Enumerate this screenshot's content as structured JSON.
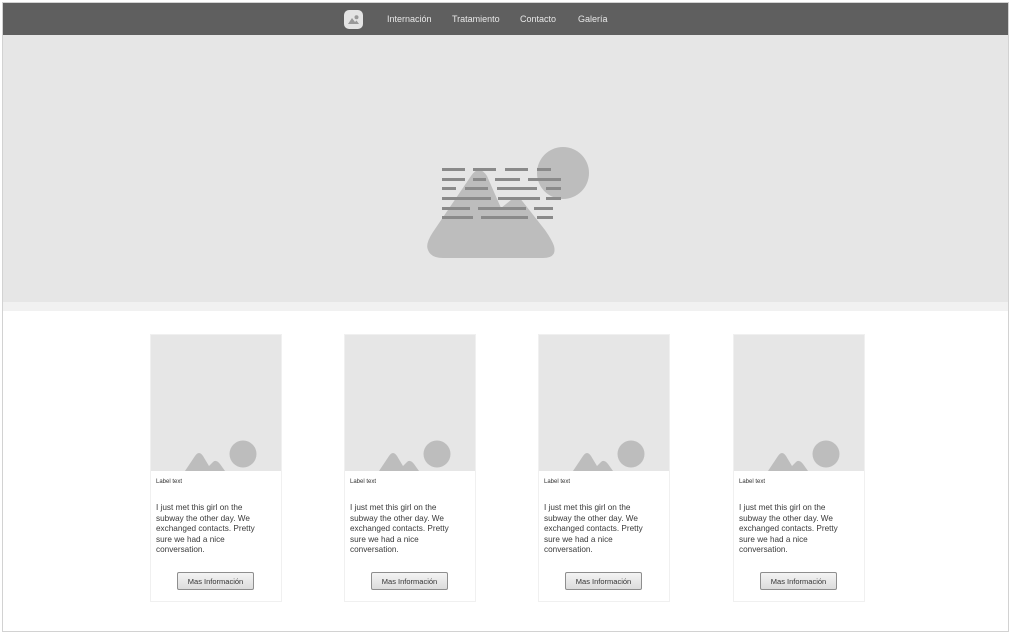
{
  "navbar": {
    "logo_icon": "image-icon",
    "items": [
      {
        "label": "Internación"
      },
      {
        "label": "Tratamiento"
      },
      {
        "label": "Contacto"
      },
      {
        "label": "Galería"
      }
    ]
  },
  "hero": {
    "image_icon": "image-placeholder-icon"
  },
  "cards": [
    {
      "label": "Label text",
      "text": "I just met this girl on the subway the other day. We exchanged contacts. Pretty sure we had a nice conversation.",
      "button": "Mas Información",
      "image_icon": "image-placeholder-icon"
    },
    {
      "label": "Label text",
      "text": "I just met this girl on the subway the other day. We exchanged contacts. Pretty sure we had a nice conversation.",
      "button": "Mas Información",
      "image_icon": "image-placeholder-icon"
    },
    {
      "label": "Label text",
      "text": "I just met this girl on the subway the other day. We exchanged contacts. Pretty sure we had a nice conversation.",
      "button": "Mas Información",
      "image_icon": "image-placeholder-icon"
    },
    {
      "label": "Label text",
      "text": "I just met this girl on the subway the other day. We exchanged contacts. Pretty sure we had a nice conversation.",
      "button": "Mas Información",
      "image_icon": "image-placeholder-icon"
    }
  ],
  "colors": {
    "navbar": "#5f5f5f",
    "placeholder": "#e6e6e6",
    "placeholder_shape": "#bdbdbd"
  }
}
